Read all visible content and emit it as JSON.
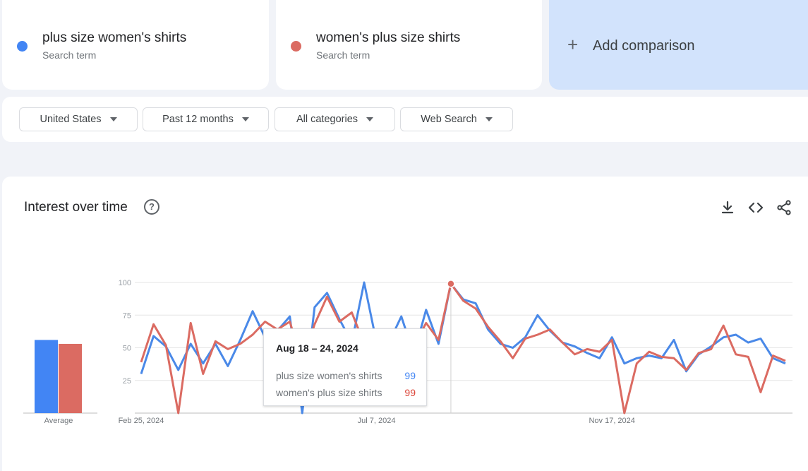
{
  "terms": [
    {
      "name": "plus size women's shirts",
      "subtitle": "Search term",
      "color": "#4285f4"
    },
    {
      "name": "women's plus size shirts",
      "subtitle": "Search term",
      "color": "#db4437"
    }
  ],
  "add_comparison": {
    "label": "Add comparison"
  },
  "filters": {
    "region": "United States",
    "time_range": "Past 12 months",
    "category": "All categories",
    "search_type": "Web Search"
  },
  "panel": {
    "title": "Interest over time",
    "help_icon": "help-circle-icon",
    "tools": [
      "download-icon",
      "embed-code-icon",
      "share-icon"
    ]
  },
  "tooltip": {
    "date": "Aug 18 – 24, 2024",
    "rows": [
      {
        "label": "plus size women's shirts",
        "value": "99",
        "color": "#4285f4"
      },
      {
        "label": "women's plus size shirts",
        "value": "99",
        "color": "#db4437"
      }
    ]
  },
  "chart_data": {
    "type": "line",
    "y_ticks": [
      "25",
      "50",
      "75",
      "100"
    ],
    "ylim": [
      0,
      100
    ],
    "x_labels": [
      "Feb 25, 2024",
      "Jul 7, 2024",
      "Nov 17, 2024"
    ],
    "x_label_week_index": [
      0,
      19,
      38
    ],
    "highlight_week_index": 25,
    "average": {
      "label": "Average",
      "values": [
        56,
        53
      ]
    },
    "series": [
      {
        "name": "plus size women's shirts",
        "color": "#4285f4",
        "values": [
          30,
          59,
          51,
          33,
          53,
          38,
          53,
          36,
          56,
          78,
          58,
          63,
          74,
          0,
          81,
          92,
          72,
          54,
          100,
          54,
          54,
          74,
          45,
          79,
          53,
          99,
          87,
          84,
          64,
          53,
          50,
          58,
          75,
          63,
          54,
          51,
          46,
          42,
          58,
          38,
          42,
          44,
          42,
          56,
          32,
          45,
          51,
          58,
          60,
          54,
          57,
          42,
          38
        ]
      },
      {
        "name": "women's plus size shirts",
        "color": "#db4437",
        "values": [
          39,
          68,
          52,
          0,
          69,
          30,
          55,
          49,
          53,
          60,
          70,
          64,
          70,
          38,
          68,
          89,
          70,
          77,
          53,
          56,
          53,
          58,
          51,
          69,
          56,
          99,
          86,
          80,
          66,
          55,
          42,
          57,
          60,
          64,
          54,
          45,
          49,
          47,
          56,
          0,
          38,
          47,
          43,
          42,
          33,
          46,
          49,
          67,
          45,
          43,
          16,
          44,
          40
        ]
      }
    ]
  }
}
